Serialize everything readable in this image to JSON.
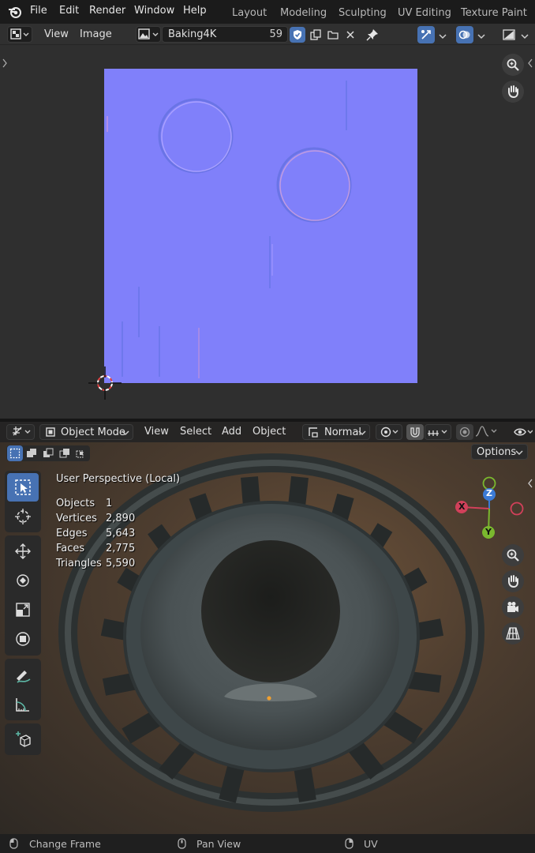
{
  "topbar": {
    "menus": [
      "File",
      "Edit",
      "Render",
      "Window",
      "Help"
    ],
    "workspaces": [
      "Layout",
      "Modeling",
      "Sculpting",
      "UV Editing",
      "Texture Paint"
    ]
  },
  "image_editor": {
    "menus": [
      "View",
      "Image"
    ],
    "image_name": "Baking4K",
    "users_count": "59"
  },
  "viewport": {
    "mode": "Object Mode",
    "menus": [
      "View",
      "Select",
      "Add",
      "Object"
    ],
    "orientation": "Normal",
    "options_label": "Options",
    "view_title": "User Perspective (Local)",
    "stats": [
      {
        "label": "Objects",
        "value": "1"
      },
      {
        "label": "Vertices",
        "value": "2,890"
      },
      {
        "label": "Edges",
        "value": "5,643"
      },
      {
        "label": "Faces",
        "value": "2,775"
      },
      {
        "label": "Triangles",
        "value": "5,590"
      }
    ],
    "gizmo": {
      "x": "X",
      "y": "Y",
      "z": "Z"
    }
  },
  "statusbar": {
    "items": [
      "Change Frame",
      "Pan View",
      "UV"
    ]
  },
  "colors": {
    "accent": "#4772b3",
    "normal_map": "#8080ff",
    "axis_x": "#d1405a",
    "axis_y": "#7ab82e",
    "axis_z": "#3b7bd6"
  }
}
